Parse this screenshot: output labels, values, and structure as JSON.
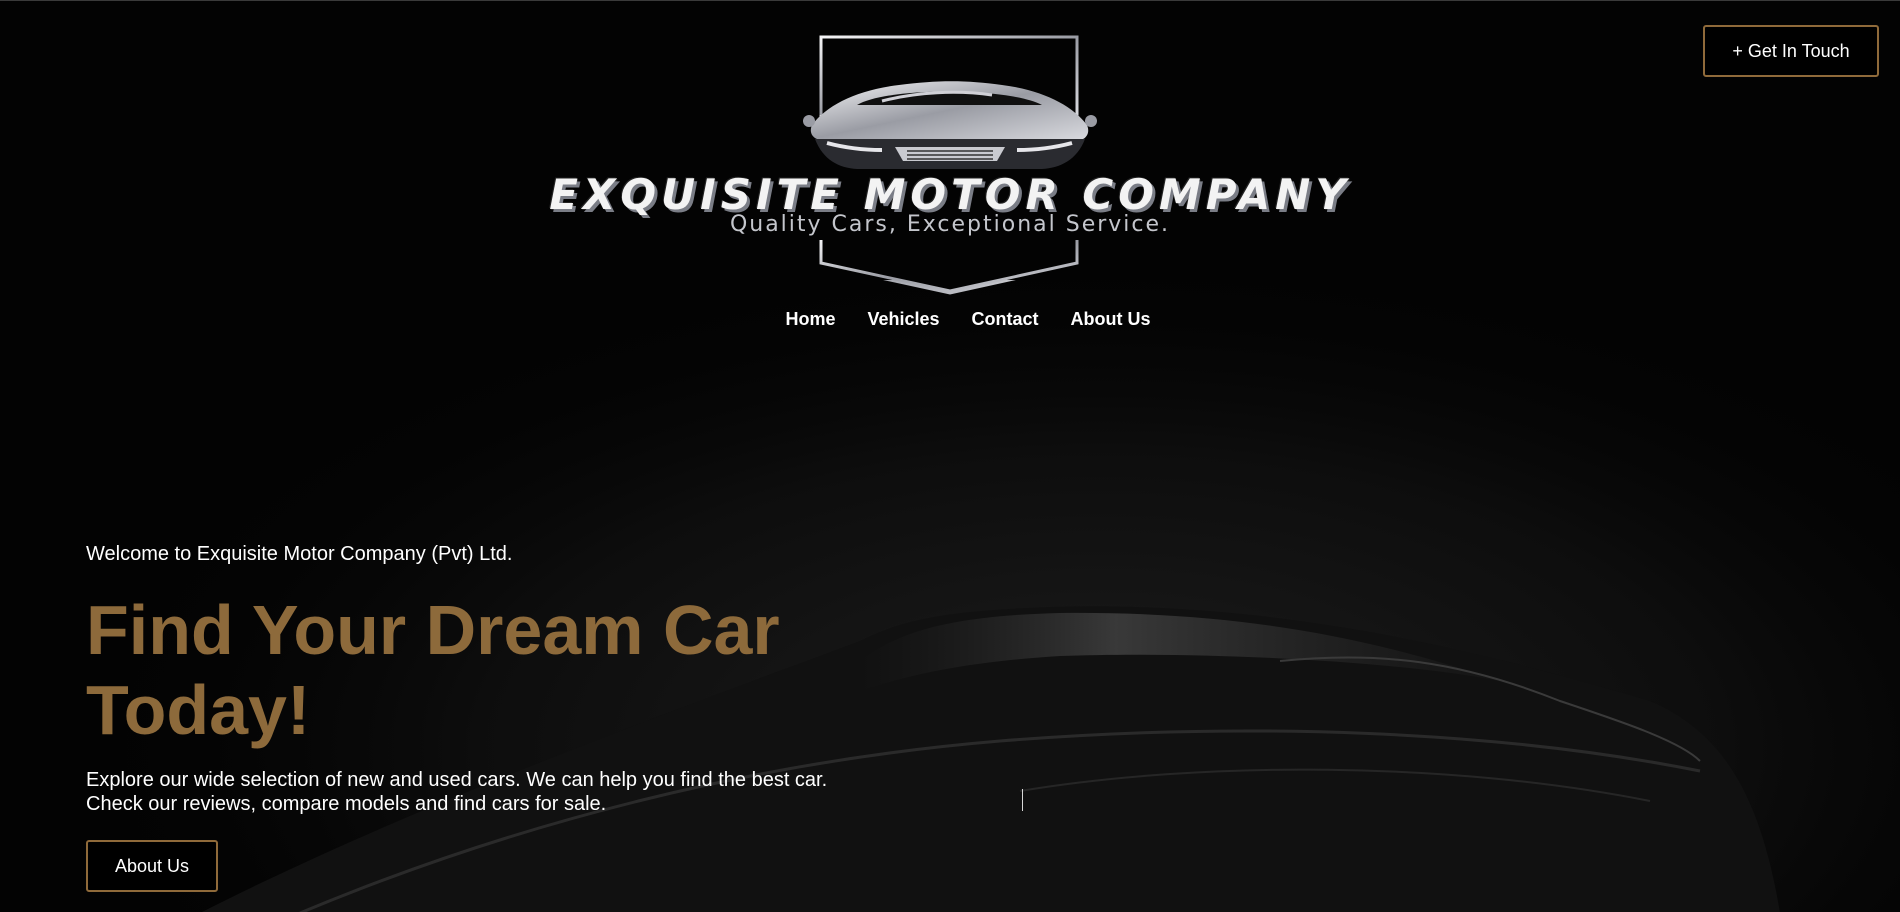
{
  "header": {
    "cta_label": "+ Get In Touch"
  },
  "logo": {
    "name": "EXQUISITE MOTOR COMPANY",
    "tagline": "Quality Cars, Exceptional Service."
  },
  "nav": {
    "items": [
      "Home",
      "Vehicles",
      "Contact",
      "About Us"
    ]
  },
  "hero": {
    "welcome": "Welcome to Exquisite Motor Company (Pvt) Ltd.",
    "headline": "Find Your Dream Car Today!",
    "description_line1": "Explore our wide selection of new and used cars. We can help you find the best car.",
    "description_line2": "Check our reviews, compare models and find cars for sale.",
    "button_label": "About Us"
  },
  "colors": {
    "accent": "#8d6a3b",
    "background": "#030303",
    "text": "#ffffff"
  }
}
